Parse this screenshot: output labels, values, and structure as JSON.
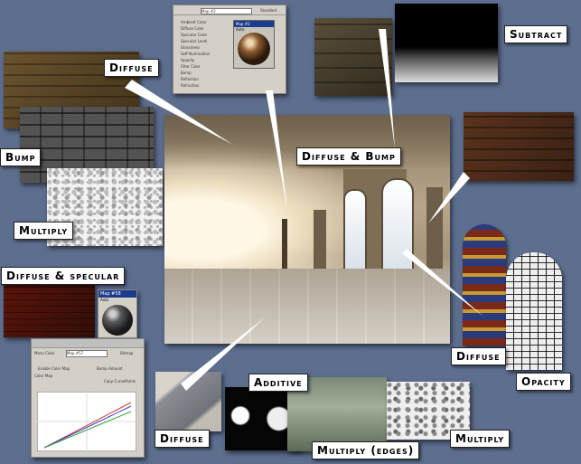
{
  "labels": {
    "diffuse_top": "Diffuse",
    "bump": "Bump",
    "multiply_left": "Multiply",
    "diffuse_specular": "Diffuse & specular",
    "diffuse_bump": "Diffuse & Bump",
    "subtract": "Subtract",
    "diffuse_right": "Diffuse",
    "opacity": "Opacity",
    "diffuse_bottom": "Diffuse",
    "additive": "Additive",
    "multiply_edges": "Multiply (edges)",
    "multiply_right": "Multiply"
  },
  "material_panel_top": {
    "title": "Map #2",
    "standard_label": "Standard",
    "channels": [
      "Ambient Color",
      "Diffuse Color",
      "Specular Color",
      "Specular Level",
      "Glossiness",
      "Self-Illumination",
      "Opacity",
      "Filter Color",
      "Bump",
      "Reflection",
      "Refraction"
    ],
    "map_title": "Map #2",
    "auto_label": "Auto"
  },
  "material_swatch_small": {
    "map_title": "Map #58",
    "auto_label": "Auto"
  },
  "output_panel": {
    "title": "Map #57",
    "rows": [
      "Mono Color",
      "Enable Color Map",
      "Bump Amount",
      "Color Map",
      "Copy CurvePoints"
    ],
    "button_label": "Bitmap"
  },
  "colors": {
    "background": "#5d6e8f",
    "label_bg": "#ffffff",
    "arrow": "#ffffff"
  }
}
